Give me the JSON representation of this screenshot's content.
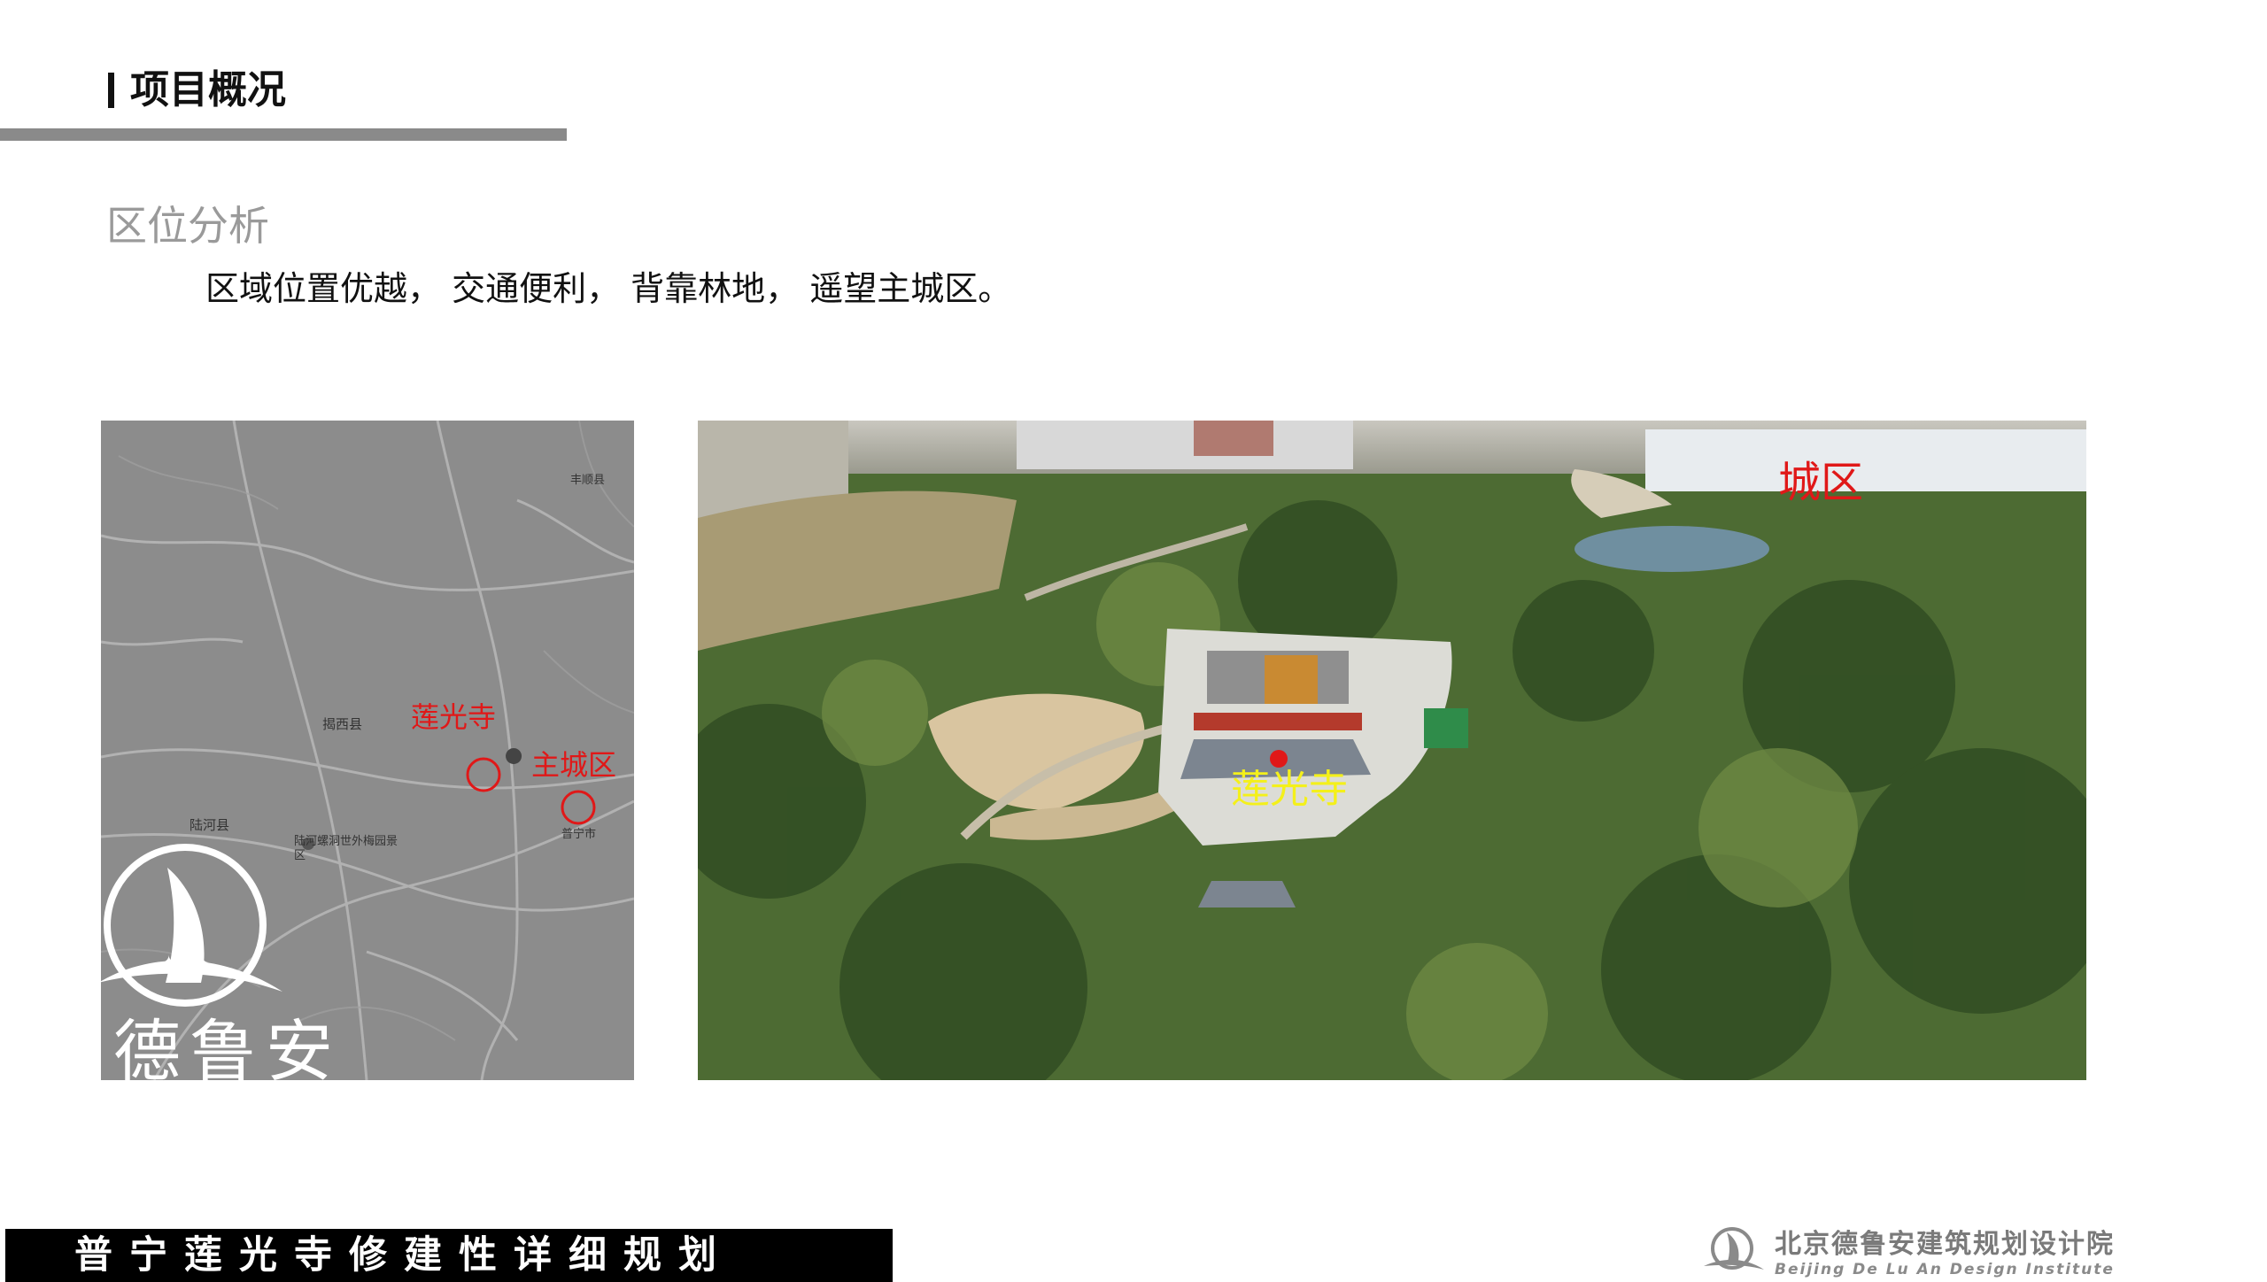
{
  "header": {
    "title": "项目概况"
  },
  "section": {
    "subtitle": "区位分析",
    "description": "区域位置优越， 交通便利， 背靠林地， 遥望主城区。"
  },
  "map": {
    "labels": {
      "temple": "莲光寺",
      "main_city": "主城区",
      "county_jiexi": "揭西县",
      "county_luhe": "陆河县",
      "county_fengshun": "丰顺县",
      "city_puning": "普宁市",
      "scenic_area": "陆河螺洞世外梅园景区"
    },
    "logo_text": "德鲁安",
    "colors": {
      "marker": "#e01818",
      "background": "#8c8c8c"
    }
  },
  "photo": {
    "labels": {
      "city_area": "城区",
      "temple": "莲光寺"
    },
    "colors": {
      "city_label": "#e01818",
      "temple_label": "#f4f01a",
      "dot": "#e01818"
    }
  },
  "footer": {
    "project_name": "普宁莲光寺修建性详细规划",
    "org_cn": "北京德鲁安建筑规划设计院",
    "org_en": "Beijing De Lu An Design Institute"
  }
}
